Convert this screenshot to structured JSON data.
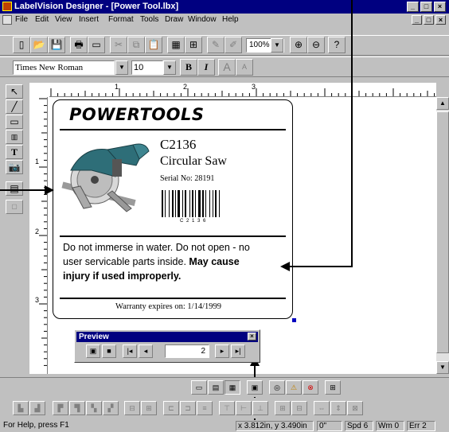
{
  "window": {
    "title": "LabelVision Designer - [Power Tool.lbx]",
    "controls": [
      "_",
      "□",
      "×"
    ]
  },
  "menu": {
    "items": [
      "File",
      "Edit",
      "View",
      "Insert",
      "Format",
      "Tools",
      "Draw",
      "Window",
      "Help"
    ]
  },
  "toolbar": {
    "zoom": "100%"
  },
  "format_bar": {
    "font": "Times New Roman",
    "size": "10",
    "bold": "B",
    "italic": "I",
    "grow": "A",
    "shrink": "A"
  },
  "ruler": {
    "h_marks": [
      "1",
      "2",
      "3"
    ],
    "v_marks": [
      "1",
      "2",
      "3"
    ]
  },
  "label": {
    "brand": "POWERTOOLS",
    "model": "C2136",
    "product": "Circular Saw",
    "serial": "Serial No: 28191",
    "barcode_text": "C 2 1 3 6",
    "warning_line1": "Do not immerse in water.  Do not open - no",
    "warning_line2a": "user servicable parts inside.",
    "warning_line2b": "May cause",
    "warning_line3": "injury if used improperly.",
    "warranty": "Warranty expires on: 1/14/1999"
  },
  "preview": {
    "title": "Preview",
    "page": "2"
  },
  "status": {
    "help": "For Help, press F1",
    "coords": "x 3.812in, y 3.490in",
    "angle": "0\"",
    "speed": "Spd 6",
    "wm": "Wm 0",
    "err": "Err 2"
  },
  "colors": {
    "titlebar": "#000080",
    "face": "#c0c0c0",
    "saw_body": "#2e6e78"
  }
}
